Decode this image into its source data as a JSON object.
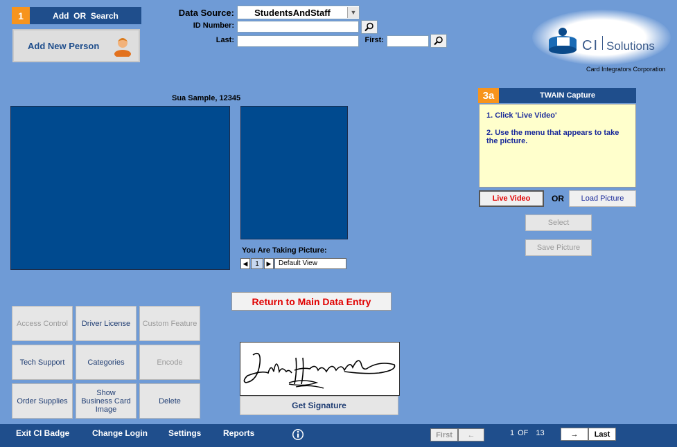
{
  "section1": {
    "number": "1",
    "title": "Add  OR  Search"
  },
  "add_new_person": {
    "label": "Add New Person"
  },
  "search": {
    "data_source_label": "Data Source:",
    "data_source_value": "StudentsAndStaff",
    "id_label": "ID Number:",
    "id_value": "",
    "last_label": "Last:",
    "last_value": "",
    "first_label": "First:",
    "first_value": ""
  },
  "logo": {
    "brand_ci": "CI",
    "brand_solutions": "Solutions",
    "tagline": "Card Integrators Corporation"
  },
  "person": {
    "name_id": "Sua Sample, 12345"
  },
  "picture": {
    "taking_label": "You Are Taking Picture:",
    "index": "1",
    "view": "Default View"
  },
  "twain": {
    "number": "3a",
    "title": "TWAIN Capture",
    "instruction1": "1. Click 'Live Video'",
    "instruction2": "2. Use the menu that appears to take the picture.",
    "live_video": "Live Video",
    "or_label": "OR",
    "load_picture": "Load Picture",
    "select": "Select",
    "save_picture": "Save Picture"
  },
  "return_button": "Return to Main Data Entry",
  "grid": {
    "access_control": "Access Control",
    "driver_license": "Driver License",
    "custom_feature": "Custom Feature",
    "tech_support": "Tech Support",
    "categories": "Categories",
    "encode": "Encode",
    "order_supplies": "Order Supplies",
    "show_business_card": "Show Business Card Image",
    "delete": "Delete"
  },
  "signature": {
    "get_signature": "Get Signature",
    "signature_text": "John Hancock"
  },
  "footer": {
    "exit": "Exit CI Badge",
    "change_login": "Change Login",
    "settings": "Settings",
    "reports": "Reports",
    "first": "First",
    "prev": "←",
    "record": "1",
    "of": "OF",
    "total": "13",
    "next": "→",
    "last": "Last"
  },
  "colors": {
    "background": "#6f9bd6",
    "header": "#1f4e8c",
    "badge": "#f7941d",
    "photo_panel": "#004a8f",
    "instruction_bg": "#ffffcc",
    "return_text": "#e00000"
  }
}
